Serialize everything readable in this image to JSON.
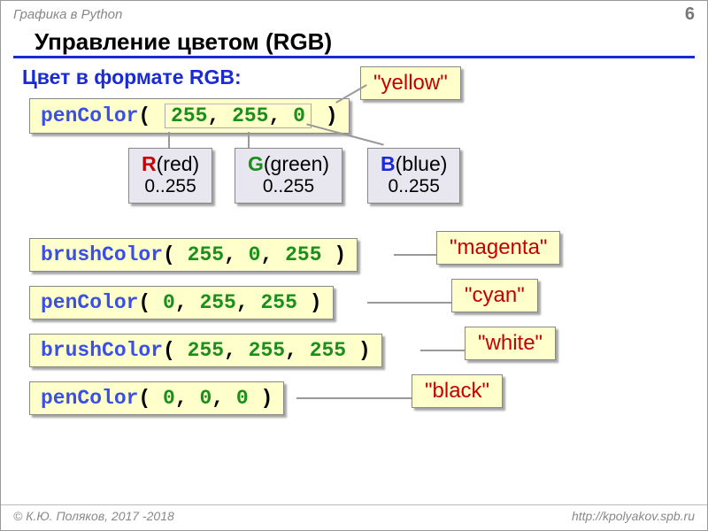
{
  "header": {
    "topic": "Графика в Python",
    "page": "6"
  },
  "title": "Управление цветом (RGB)",
  "subtitle": "Цвет в формате RGB:",
  "example1": {
    "fn": "penColor",
    "open": "( ",
    "r": "255",
    "c1": ", ",
    "g": "255",
    "c2": ", ",
    "b": "0",
    "close": " )",
    "callout": "\"yellow\""
  },
  "channels": {
    "r": {
      "letter": "R",
      "word": "(red)",
      "range": "0..255"
    },
    "g": {
      "letter": "G",
      "word": "(green)",
      "range": "0..255"
    },
    "b": {
      "letter": "B",
      "word": "(blue)",
      "range": "0..255"
    }
  },
  "rows": [
    {
      "fn": "brushColor",
      "r": "255",
      "g": "0",
      "b": "255",
      "callout": "\"magenta\""
    },
    {
      "fn": "penColor",
      "r": "0",
      "g": "255",
      "b": "255",
      "callout": "\"cyan\""
    },
    {
      "fn": "brushColor",
      "r": "255",
      "g": "255",
      "b": "255",
      "callout": "\"white\""
    },
    {
      "fn": "penColor",
      "r": "0",
      "g": "0",
      "b": "0",
      "callout": "\"black\""
    }
  ],
  "footer": {
    "left": "© К.Ю. Поляков, 2017 -2018",
    "right": "http://kpolyakov.spb.ru"
  }
}
